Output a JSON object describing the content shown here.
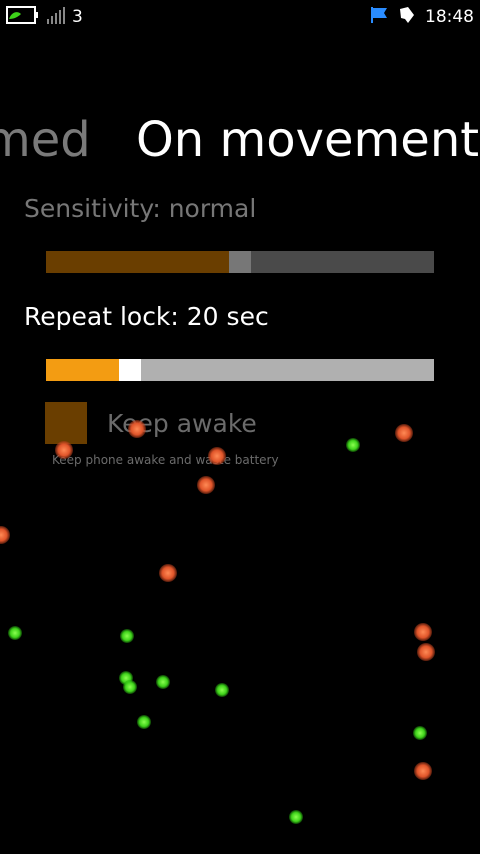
{
  "status_bar": {
    "signal_text": "3",
    "time": "18:48",
    "left_icons": [
      "battery-charging-icon",
      "signal-bars-icon"
    ],
    "right_icons": [
      "flag-icon",
      "notification-icon"
    ]
  },
  "pivot": {
    "previous_label": "med",
    "current_label": "On movement"
  },
  "sensitivity": {
    "label": "Sensitivity: normal",
    "value_fraction": 0.5,
    "fill_color": "#6a3e00",
    "thumb_color": "#777777",
    "track_color": "#4a4a4a"
  },
  "repeat_lock": {
    "label": "Repeat lock: 20 sec",
    "value_fraction": 0.2,
    "fill_color": "#f39c12",
    "thumb_color": "#ffffff",
    "track_color": "#b0b0b0"
  },
  "keep_awake": {
    "label": "Keep awake",
    "description": "Keep phone awake and waste battery",
    "checked": false,
    "box_color": "#6a3e00"
  },
  "particles": {
    "green_color": "#3ed21a",
    "orange_color": "#e0552a"
  }
}
